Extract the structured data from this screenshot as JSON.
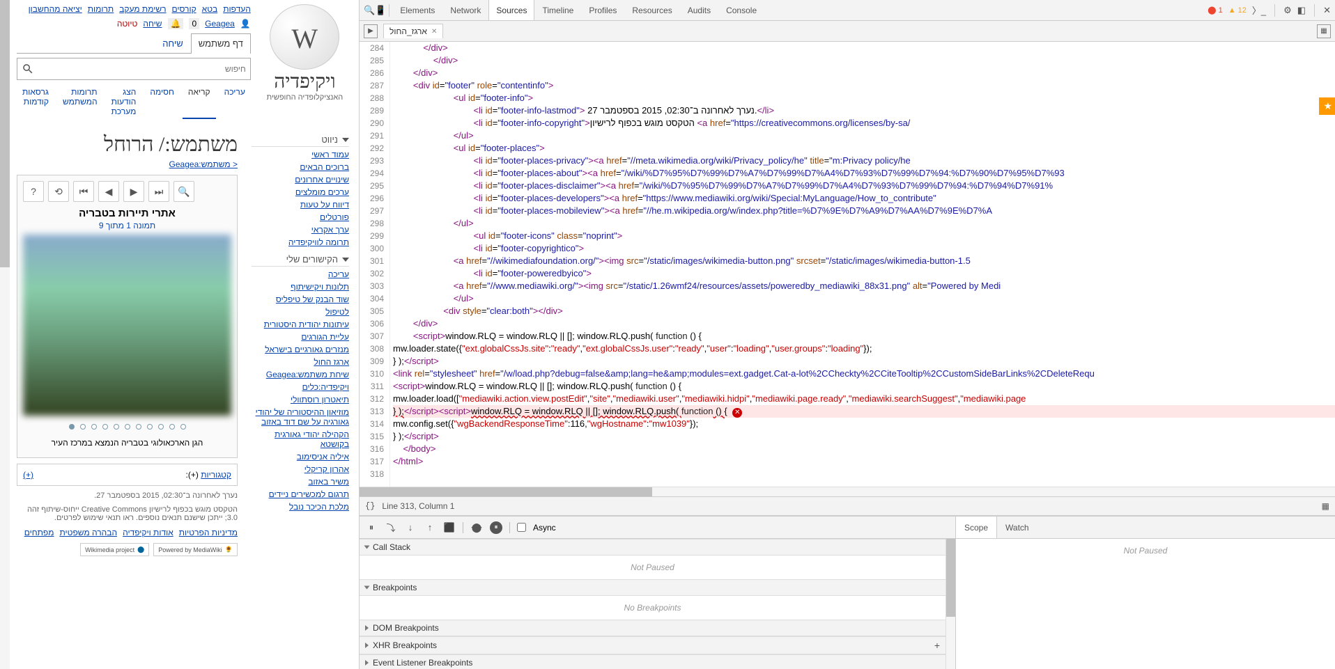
{
  "wikipedia": {
    "name_txt": "ויקיפדיה",
    "sub_txt": "האנציקלופדיה החופשית",
    "user_tabs": {
      "userpage": "דף משתמש",
      "talk": "שיחה"
    },
    "action_tabs": {
      "read": "קריאה",
      "edit": "עריכה"
    },
    "top_nav": [
      "העדפות",
      "בטא",
      "קורסים",
      "רשימת מעקב",
      "תרומות",
      "יציאה מהחשבון"
    ],
    "user_nav": {
      "user": "Geagea",
      "talk": "שיחה",
      "draft": "טיוטה"
    },
    "search_placeholder": "חיפוש",
    "page_title": "משתמש:/ הרוחל",
    "breadcrumb": "< משתמש:Geagea",
    "nav_hdr": "ניווט",
    "nav_links": [
      "עמוד ראשי",
      "ברוכים הבאים",
      "שינויים אחרונים",
      "ערכים מומלצים",
      "דיווח על טעות",
      "פורטלים",
      "ערך אקראי",
      "תרומה לוויקיפדיה"
    ],
    "my_links_hdr": "הקישורים שלי",
    "my_links": [
      "עריכה",
      "תלונות ויקישיתוף",
      "שוד הבנק של טיפליס",
      "לטיפול",
      "עיתונות יהודית היסטורית",
      "עליית הגורגים",
      "מנזרים גאורגיים בישראל",
      "ארגז החול",
      "שיחת משתמש:Geagea",
      "ויקיפדיה:כלים",
      "תיאטרון רוסתוולי",
      "מוזיאון ההיסטוריה של יהודי גאורגיה על שם דוד באזוב",
      "הקהילה יהודי גאורגית בקושטא",
      "איליה אניסימוב",
      "אהרון קריקלי",
      "משיר באזוב",
      "תרגום למכשירים ניידים",
      "מלכת הכיכר נובל"
    ],
    "gallery": {
      "title": "אתרי תיירות בטבריה",
      "subtitle": "תמונה 1 מתוך 9",
      "caption": "הגן הארכאולוגי בטבריה הנמצא במרכז העיר",
      "total_dots": 11
    },
    "categories": {
      "label": "קטגוריות",
      "plus": "(+):",
      "plus2": "(+)"
    },
    "footer_lastmod": "נערך לאחרונה ב־02:30, 2015 בספטמבר 27.",
    "footer_license": "הטקסט מוגש בכפוף לרישיון Creative Commons ייחוס-שיתוף זהה 3.0; ייתכן שישנם תנאים נוספים. ראו תנאי שימוש לפרטים.",
    "footer_links": [
      "מדיניות הפרטיות",
      "אודות ויקיפדיה",
      "הבהרה משפטית",
      "מפתחים"
    ],
    "badge1": "Powered by MediaWiki",
    "badge2": "Wikimedia project"
  },
  "devtools": {
    "tabs": [
      "Elements",
      "Network",
      "Sources",
      "Timeline",
      "Profiles",
      "Resources",
      "Audits",
      "Console"
    ],
    "active_tab": "Sources",
    "error_count": "1",
    "warn_count": "12",
    "file_tab": "ארגז_החול",
    "status_line": "Line 313, Column 1",
    "scope_tabs": [
      "Scope",
      "Watch"
    ],
    "not_paused": "Not Paused",
    "async": "Async",
    "panels": {
      "callstack": "Call Stack",
      "breakpoints": "Breakpoints",
      "dom": "DOM Breakpoints",
      "xhr": "XHR Breakpoints",
      "event": "Event Listener Breakpoints"
    },
    "panel_empty": {
      "callstack": "Not Paused",
      "breakpoints": "No Breakpoints"
    },
    "code_lines": [
      {
        "n": 284,
        "html": "            <span class='c-tag'>&lt;/div&gt;</span>"
      },
      {
        "n": 285,
        "html": "                <span class='c-tag'>&lt;/div&gt;</span>"
      },
      {
        "n": 286,
        "html": "        <span class='c-tag'>&lt;/div&gt;</span>"
      },
      {
        "n": 287,
        "html": "        <span class='c-tag'>&lt;div</span> <span class='c-attr'>id</span>=<span class='c-str'>\"footer\"</span> <span class='c-attr'>role</span>=<span class='c-str'>\"contentinfo\"</span><span class='c-tag'>&gt;</span>"
      },
      {
        "n": 288,
        "html": "                        <span class='c-tag'>&lt;ul</span> <span class='c-attr'>id</span>=<span class='c-str'>\"footer-info\"</span><span class='c-tag'>&gt;</span>"
      },
      {
        "n": 289,
        "html": "                                <span class='c-tag'>&lt;li</span> <span class='c-attr'>id</span>=<span class='c-str'>\"footer-info-lastmod\"</span><span class='c-tag'>&gt;</span> נערך לאחרונה ב־02:30, 2015 בספטמבר 27.<span class='c-tag'>&lt;/li&gt;</span>"
      },
      {
        "n": 290,
        "html": "                                <span class='c-tag'>&lt;li</span> <span class='c-attr'>id</span>=<span class='c-str'>\"footer-info-copyright\"</span><span class='c-tag'>&gt;</span>הטקסט מוגש בכפוף לרישיון <span class='c-tag'>&lt;a</span> <span class='c-attr'>href</span>=<span class='c-str'>\"https://creativecommons.org/licenses/by-sa/</span>"
      },
      {
        "n": 291,
        "html": "                        <span class='c-tag'>&lt;/ul&gt;</span>"
      },
      {
        "n": 292,
        "html": "                        <span class='c-tag'>&lt;ul</span> <span class='c-attr'>id</span>=<span class='c-str'>\"footer-places\"</span><span class='c-tag'>&gt;</span>"
      },
      {
        "n": 293,
        "html": "                                <span class='c-tag'>&lt;li</span> <span class='c-attr'>id</span>=<span class='c-str'>\"footer-places-privacy\"</span><span class='c-tag'>&gt;&lt;a</span> <span class='c-attr'>href</span>=<span class='c-str'>\"//meta.wikimedia.org/wiki/Privacy_policy/he\"</span> <span class='c-attr'>title</span>=<span class='c-str'>\"m:Privacy policy/he</span>"
      },
      {
        "n": 294,
        "html": "                                <span class='c-tag'>&lt;li</span> <span class='c-attr'>id</span>=<span class='c-str'>\"footer-places-about\"</span><span class='c-tag'>&gt;&lt;a</span> <span class='c-attr'>href</span>=<span class='c-str'>\"/wiki/%D7%95%D7%99%D7%A7%D7%99%D7%A4%D7%93%D7%99%D7%94:%D7%90%D7%95%D7%93</span>"
      },
      {
        "n": 295,
        "html": "                                <span class='c-tag'>&lt;li</span> <span class='c-attr'>id</span>=<span class='c-str'>\"footer-places-disclaimer\"</span><span class='c-tag'>&gt;&lt;a</span> <span class='c-attr'>href</span>=<span class='c-str'>\"/wiki/%D7%95%D7%99%D7%A7%D7%99%D7%A4%D7%93%D7%99%D7%94:%D7%94%D7%91%</span>"
      },
      {
        "n": 296,
        "html": "                                <span class='c-tag'>&lt;li</span> <span class='c-attr'>id</span>=<span class='c-str'>\"footer-places-developers\"</span><span class='c-tag'>&gt;&lt;a</span> <span class='c-attr'>href</span>=<span class='c-str'>\"https://www.mediawiki.org/wiki/Special:MyLanguage/How_to_contribute\"</span>"
      },
      {
        "n": 297,
        "html": "                                <span class='c-tag'>&lt;li</span> <span class='c-attr'>id</span>=<span class='c-str'>\"footer-places-mobileview\"</span><span class='c-tag'>&gt;&lt;a</span> <span class='c-attr'>href</span>=<span class='c-str'>\"//he.m.wikipedia.org/w/index.php?title=%D7%9E%D7%A9%D7%AA%D7%9E%D7%A</span>"
      },
      {
        "n": 298,
        "html": "                        <span class='c-tag'>&lt;/ul&gt;</span>"
      },
      {
        "n": 299,
        "html": "                                <span class='c-tag'>&lt;ul</span> <span class='c-attr'>id</span>=<span class='c-str'>\"footer-icons\"</span> <span class='c-attr'>class</span>=<span class='c-str'>\"noprint\"</span><span class='c-tag'>&gt;</span>"
      },
      {
        "n": 300,
        "html": "                                <span class='c-tag'>&lt;li</span> <span class='c-attr'>id</span>=<span class='c-str'>\"footer-copyrightico\"</span><span class='c-tag'>&gt;</span>"
      },
      {
        "n": 301,
        "html": "                        <span class='c-tag'>&lt;a</span> <span class='c-attr'>href</span>=<span class='c-str'>\"//wikimediafoundation.org/\"</span><span class='c-tag'>&gt;&lt;img</span> <span class='c-attr'>src</span>=<span class='c-str'>\"/static/images/wikimedia-button.png\"</span> <span class='c-attr'>srcset</span>=<span class='c-str'>\"/static/images/wikimedia-button-1.5</span>"
      },
      {
        "n": 302,
        "html": "                                <span class='c-tag'>&lt;li</span> <span class='c-attr'>id</span>=<span class='c-str'>\"footer-poweredbyico\"</span><span class='c-tag'>&gt;</span>"
      },
      {
        "n": 303,
        "html": "                        <span class='c-tag'>&lt;a</span> <span class='c-attr'>href</span>=<span class='c-str'>\"//www.mediawiki.org/\"</span><span class='c-tag'>&gt;&lt;img</span> <span class='c-attr'>src</span>=<span class='c-str'>\"/static/1.26wmf24/resources/assets/poweredby_mediawiki_88x31.png\"</span> <span class='c-attr'>alt</span>=<span class='c-str'>\"Powered by Medi</span>"
      },
      {
        "n": 304,
        "html": "                        <span class='c-tag'>&lt;/ul&gt;</span>"
      },
      {
        "n": 305,
        "html": "                    <span class='c-tag'>&lt;div</span> <span class='c-attr'>style</span>=<span class='c-str'>\"clear:both\"</span><span class='c-tag'>&gt;&lt;/div&gt;</span>"
      },
      {
        "n": 306,
        "html": "        <span class='c-tag'>&lt;/div&gt;</span>"
      },
      {
        "n": 307,
        "html": "        <span class='c-tag'>&lt;script&gt;</span>window.RLQ = window.RLQ || []; window.RLQ.push( <span class='c-kw'>function</span> () {"
      },
      {
        "n": 308,
        "html": "mw.loader.state({<span class='c-red'>\"ext.globalCssJs.site\"</span>:<span class='c-red'>\"ready\"</span>,<span class='c-red'>\"ext.globalCssJs.user\"</span>:<span class='c-red'>\"ready\"</span>,<span class='c-red'>\"user\"</span>:<span class='c-red'>\"loading\"</span>,<span class='c-red'>\"user.groups\"</span>:<span class='c-red'>\"loading\"</span>});"
      },
      {
        "n": 309,
        "html": "} );<span class='c-tag'>&lt;/script&gt;</span>"
      },
      {
        "n": 310,
        "html": "<span class='c-tag'>&lt;link</span> <span class='c-attr'>rel</span>=<span class='c-str'>\"stylesheet\"</span> <span class='c-attr'>href</span>=<span class='c-str'>\"/w/load.php?debug=false&amp;amp;lang=he&amp;amp;modules=ext.gadget.Cat-a-lot%2CCheckty%2CCiteTooltip%2CCustomSideBarLinks%2CDeleteRequ</span>"
      },
      {
        "n": 311,
        "html": "<span class='c-tag'>&lt;script&gt;</span>window.RLQ = window.RLQ || []; window.RLQ.push( <span class='c-kw'>function</span> () {"
      },
      {
        "n": 312,
        "html": "mw.loader.load([<span class='c-red'>\"mediawiki.action.view.postEdit\"</span>,<span class='c-red'>\"site\"</span>,<span class='c-red'>\"mediawiki.user\"</span>,<span class='c-red'>\"mediawiki.hidpi\"</span>,<span class='c-red'>\"mediawiki.page.ready\"</span>,<span class='c-red'>\"mediawiki.searchSuggest\"</span>,<span class='c-red'>\"mediawiki.page</span>"
      },
      {
        "n": 313,
        "html": "<span class='c-err'>} );</span><span class='c-tag'>&lt;/script&gt;&lt;script&gt;</span><span class='c-err'>window.RLQ = window.RLQ || []; window.RLQ.push( </span><span class='c-kw'>function</span><span class='c-err'> () {</span> <span class='err-icon'>✕</span>",
        "cls": "line-highlight"
      },
      {
        "n": 314,
        "html": "mw.config.set({<span class='c-red'>\"wgBackendResponseTime\"</span>:116,<span class='c-red'>\"wgHostname\"</span>:<span class='c-red'>\"mw1039\"</span>});"
      },
      {
        "n": 315,
        "html": "} );<span class='c-tag'>&lt;/script&gt;</span>"
      },
      {
        "n": 316,
        "html": "    <span class='c-tag'>&lt;/body&gt;</span>"
      },
      {
        "n": 317,
        "html": "<span class='c-tag'>&lt;/html&gt;</span>"
      },
      {
        "n": 318,
        "html": ""
      }
    ]
  }
}
